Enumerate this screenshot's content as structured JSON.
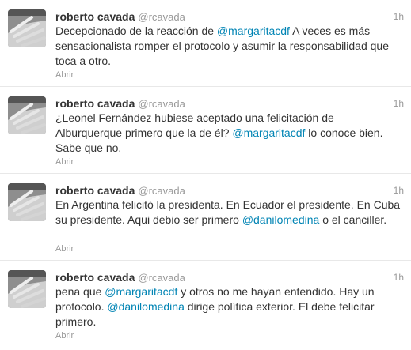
{
  "tweets": [
    {
      "name": "roberto cavada",
      "handle": "@rcavada",
      "time": "1h",
      "parts": [
        "Decepcionado de la reacción de ",
        "@margaritacdf",
        " A veces es más sensacionalista romper el protocolo y asumir la responsabilidad que toca a otro."
      ],
      "action": "Abrir"
    },
    {
      "name": "roberto cavada",
      "handle": "@rcavada",
      "time": "1h",
      "parts": [
        "¿Leonel Fernández hubiese aceptado una felicitación de Alburquerque primero que la de él? ",
        "@margaritacdf",
        " lo conoce bien. Sabe que no."
      ],
      "action": "Abrir"
    },
    {
      "name": "roberto cavada",
      "handle": "@rcavada",
      "time": "1h",
      "parts": [
        "En Argentina felicitó la presidenta. En Ecuador el presidente. En Cuba su presidente. Aqui debio ser primero ",
        "@danilomedina",
        " o el canciller."
      ],
      "action": "Abrir"
    },
    {
      "name": "roberto cavada",
      "handle": "@rcavada",
      "time": "1h",
      "parts": [
        "pena que ",
        "@margaritacdf",
        " y otros no me hayan entendido. Hay un protocolo. ",
        "@danilomedina",
        " dirige política exterior. El debe felicitar primero."
      ],
      "action": "Abrir"
    }
  ],
  "colors": {
    "mention": "#0084b4",
    "meta": "#999999",
    "text": "#333333"
  },
  "icons": {
    "avatar": "hand-photo-avatar"
  }
}
